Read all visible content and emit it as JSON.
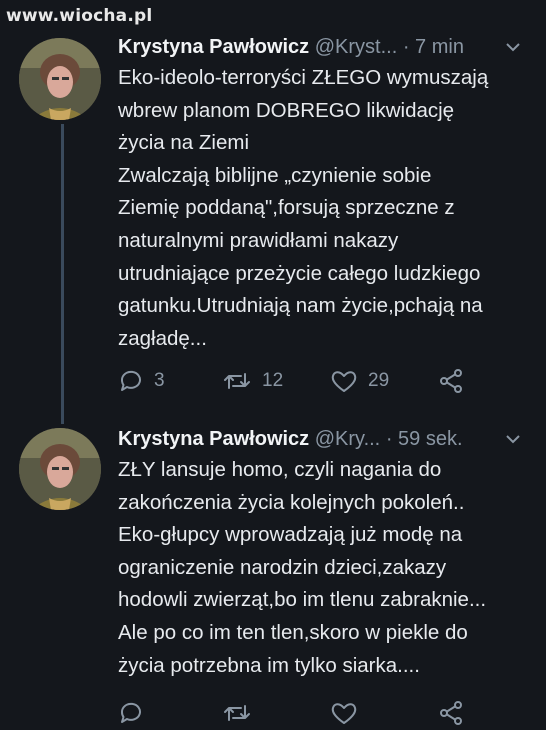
{
  "watermark": "www.wiocha.pl",
  "tweets": [
    {
      "name": "Krystyna Pawłowicz",
      "handle": "@Kryst...",
      "time": "· 7 min",
      "lines": [
        "Eko-ideolo-terroryści ZŁEGO wymuszają",
        "wbrew planom DOBREGO likwidację",
        "życia na Ziemi",
        "Zwalczają biblijne „czynienie sobie",
        "Ziemię poddaną\",forsują sprzeczne z",
        "naturalnymi prawidłami nakazy",
        "utrudniające przeżycie całego ludzkiego",
        "gatunku.Utrudniają nam życie,pchają na",
        "zagładę..."
      ],
      "replies": "3",
      "retweets": "12",
      "likes": "29"
    },
    {
      "name": "Krystyna Pawłowicz",
      "handle": "@Kry...",
      "time": "· 59 sek.",
      "lines": [
        "ZŁY lansuje homo, czyli nagania do",
        "zakończenia życia kolejnych pokoleń..",
        "Eko-głupcy wprowadzają już modę na",
        "ograniczenie narodzin dzieci,zakazy",
        "hodowli zwierząt,bo im tlenu zabraknie...",
        "Ale po co im ten tlen,skoro w piekle do",
        "życia potrzebna im tylko siarka...."
      ]
    }
  ],
  "colors": {
    "background": "#14171c",
    "text": "#e7eaee",
    "muted": "#8a96a3",
    "thread_line": "#3a4a5c"
  }
}
